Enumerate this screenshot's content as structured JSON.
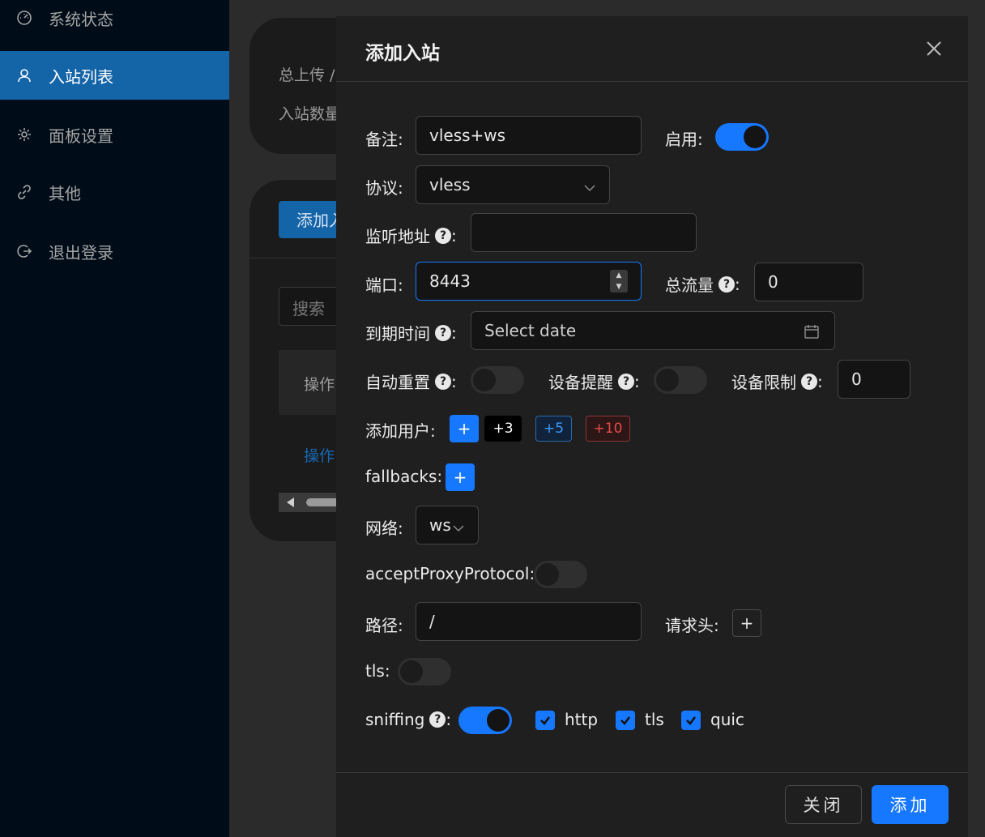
{
  "sidebar": {
    "items": [
      {
        "label": "系统状态",
        "icon": "dashboard-icon"
      },
      {
        "label": "入站列表",
        "icon": "user-icon"
      },
      {
        "label": "面板设置",
        "icon": "gear-icon"
      },
      {
        "label": "其他",
        "icon": "link-icon"
      },
      {
        "label": "退出登录",
        "icon": "logout-icon"
      }
    ]
  },
  "background": {
    "upload_label": "总上传 /",
    "inbound_count_label": "入站数量",
    "add_button": "添加入",
    "search_placeholder": "搜索",
    "col_operation": "操作",
    "row_operation_link": "操作"
  },
  "modal": {
    "title": "添加入站",
    "fields": {
      "remark_label": "备注:",
      "remark_value": "vless+ws",
      "enable_label": "启用:",
      "protocol_label": "协议:",
      "protocol_value": "vless",
      "listen_label": "监听地址",
      "port_label": "端口:",
      "port_value": "8443",
      "total_traffic_label": "总流量",
      "total_traffic_value": "0",
      "expiry_label": "到期时间",
      "expiry_placeholder": "Select date",
      "auto_reset_label": "自动重置",
      "device_alert_label": "设备提醒",
      "device_limit_label": "设备限制",
      "device_limit_value": "0",
      "add_user_label": "添加用户:",
      "fallbacks_label": "fallbacks:",
      "network_label": "网络:",
      "network_value": "ws",
      "accept_proxy_label": "acceptProxyProtocol:",
      "path_label": "路径:",
      "path_value": "/",
      "request_header_label": "请求头:",
      "tls_label": "tls:",
      "sniffing_label": "sniffing"
    },
    "user_chips": [
      "+",
      "+3",
      "+5",
      "+10"
    ],
    "sniffing_options": [
      "http",
      "tls",
      "quic"
    ],
    "colon": ":",
    "help_glyph": "?",
    "plus_glyph": "+",
    "footer": {
      "close_label": "关闭",
      "add_label": "添加"
    }
  },
  "colors": {
    "accent": "#1677ff",
    "sidebar_bg": "#000c17",
    "sidebar_active": "#1464a8",
    "modal_bg": "#1f1f1f",
    "chip_blue": "#3b9bff",
    "chip_red": "#e84b4b"
  }
}
